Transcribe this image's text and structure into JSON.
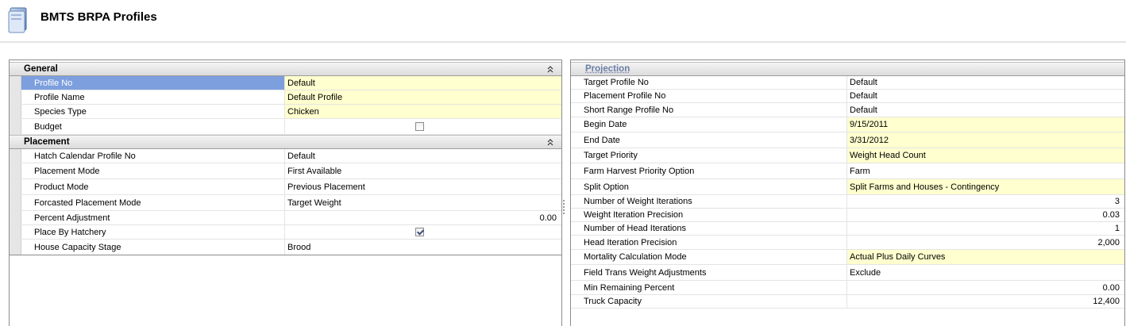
{
  "app": {
    "title": "BMTS BRPA Profiles",
    "icon": "document-icon"
  },
  "general": {
    "title": "General",
    "rows": [
      {
        "label": "Profile No",
        "value": "Default",
        "highlight": true,
        "selected": true
      },
      {
        "label": "Profile Name",
        "value": "Default Profile",
        "highlight": true
      },
      {
        "label": "Species Type",
        "value": "Chicken",
        "highlight": true
      },
      {
        "label": "Budget",
        "checked": false
      }
    ]
  },
  "placement": {
    "title": "Placement",
    "rows": [
      {
        "label": "Hatch Calendar Profile No",
        "value": "Default"
      },
      {
        "label": "Placement Mode",
        "value": "First Available"
      },
      {
        "label": "Product Mode",
        "value": "Previous Placement"
      },
      {
        "label": "Forcasted Placement Mode",
        "value": "Target Weight"
      },
      {
        "label": "Percent Adjustment",
        "value": "0.00"
      },
      {
        "label": "Place By Hatchery",
        "checked": true
      },
      {
        "label": "House Capacity Stage",
        "value": "Brood"
      }
    ]
  },
  "projection": {
    "title": "Projection",
    "rows": [
      {
        "label": "Target Profile No",
        "value": "Default"
      },
      {
        "label": "Placement Profile No",
        "value": "Default"
      },
      {
        "label": "Short Range Profile No",
        "value": "Default"
      },
      {
        "label": "Begin Date",
        "value": "9/15/2011",
        "highlight": true
      },
      {
        "label": "End Date",
        "value": "3/31/2012",
        "highlight": true
      },
      {
        "label": "Target Priority",
        "value": "Weight Head Count",
        "highlight": true
      },
      {
        "label": "Farm Harvest Priority Option",
        "value": "Farm"
      },
      {
        "label": "Split Option",
        "value": "Split Farms and Houses - Contingency",
        "highlight": true
      },
      {
        "label": "Number of Weight Iterations",
        "value": "3"
      },
      {
        "label": "Weight Iteration Precision",
        "value": "0.03"
      },
      {
        "label": "Number of Head Iterations",
        "value": "1"
      },
      {
        "label": "Head Iteration Precision",
        "value": "2,000"
      },
      {
        "label": "Mortality Calculation Mode",
        "value": "Actual Plus Daily Curves",
        "highlight": true
      },
      {
        "label": "Field Trans Weight Adjustments",
        "value": "Exclude"
      },
      {
        "label": "Min Remaining Percent",
        "value": "0.00"
      },
      {
        "label": "Truck Capacity",
        "value": "12,400"
      }
    ]
  },
  "colors": {
    "highlight_bg": "#ffffcf",
    "selected_bg": "#7d9fde",
    "section_title_projection": "#6b7fa8"
  }
}
